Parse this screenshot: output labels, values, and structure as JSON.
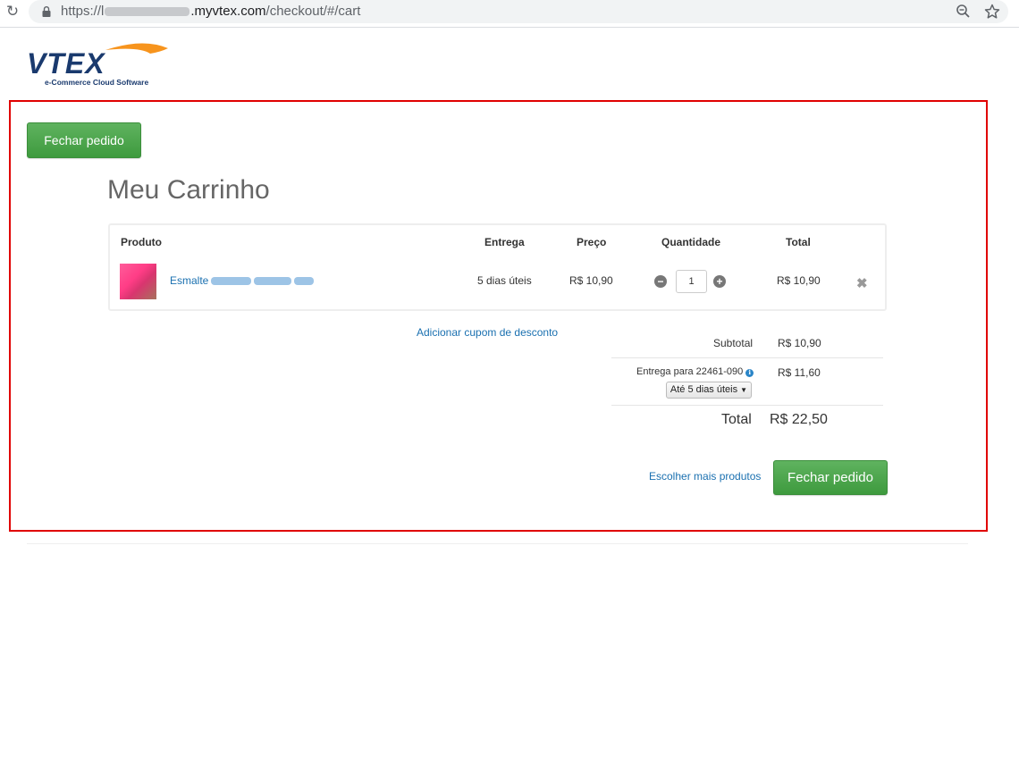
{
  "browser": {
    "url_prefix": "https://l",
    "url_host": ".myvtex.com",
    "url_path": "/checkout/#/cart"
  },
  "logo": {
    "wordmark": "VTEX",
    "tagline": "e-Commerce Cloud Software"
  },
  "actions": {
    "checkout_top": "Fechar pedido",
    "checkout_bottom": "Fechar pedido",
    "more_products": "Escolher mais produtos",
    "coupon": "Adicionar cupom de desconto"
  },
  "page": {
    "title": "Meu Carrinho"
  },
  "table": {
    "headers": {
      "product": "Produto",
      "delivery": "Entrega",
      "price": "Preço",
      "quantity": "Quantidade",
      "total": "Total"
    },
    "rows": [
      {
        "name": "Esmalte",
        "delivery": "5 dias úteis",
        "price": "R$ 10,90",
        "quantity": "1",
        "total": "R$ 10,90"
      }
    ]
  },
  "summary": {
    "subtotal_label": "Subtotal",
    "subtotal_value": "R$ 10,90",
    "shipping_label": "Entrega para 22461-090",
    "shipping_value": "R$ 11,60",
    "shipping_option": "Até 5 dias úteis",
    "total_label": "Total",
    "total_value": "R$ 22,50"
  },
  "colors": {
    "accent_green": "#4cae4c",
    "link_blue": "#1a70b0",
    "highlight_red": "#e00000"
  },
  "icons": [
    "reload-icon",
    "lock-icon",
    "zoom-icon",
    "star-icon",
    "minus-icon",
    "plus-icon",
    "remove-icon",
    "info-icon",
    "caret-down-icon"
  ]
}
